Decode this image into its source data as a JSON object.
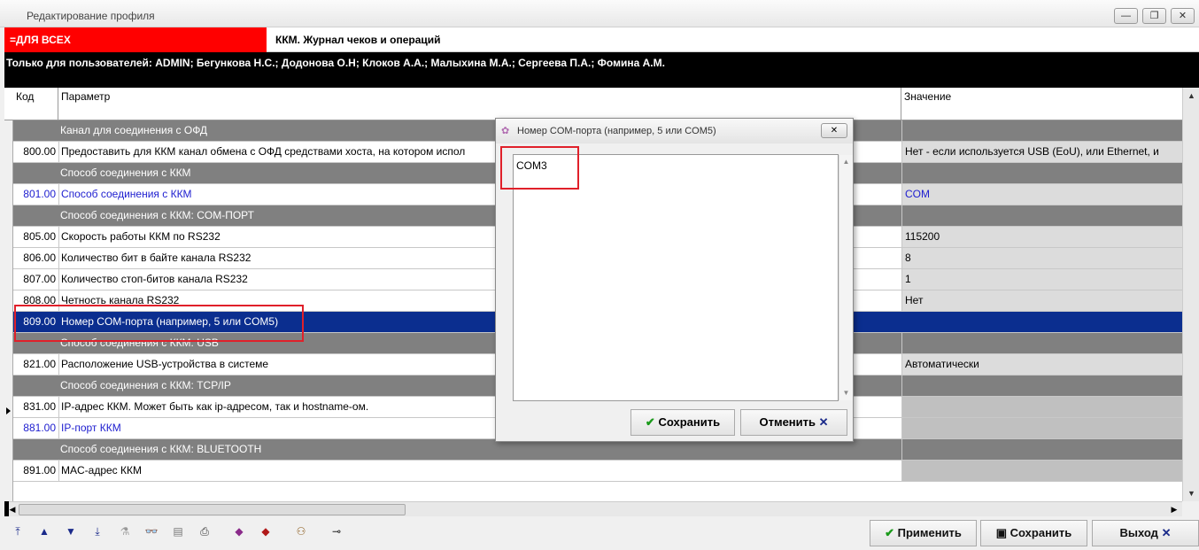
{
  "window": {
    "title": "Редактирование профиля",
    "min_glyph": "—",
    "max_glyph": "❐",
    "close_glyph": "✕"
  },
  "header": {
    "group": "=ДЛЯ ВСЕХ",
    "journal": "ККМ. Журнал чеков и операций",
    "users_line": "Только для пользователей: ADMIN; Бегункова Н.С.; Додонова О.Н; Клоков А.А.; Малыхина М.А.; Сергеева П.А.; Фомина А.М."
  },
  "grid": {
    "columns": {
      "code": "Код",
      "param": "Параметр",
      "value": "Значение"
    },
    "rows": [
      {
        "type": "group",
        "code": "",
        "param": "Канал для соединения с ОФД",
        "value": ""
      },
      {
        "type": "data",
        "code": "800.00",
        "param": "Предоставить для ККМ канал обмена с ОФД средствами хоста, на котором испол",
        "value": "Нет - если используется USB (EoU), или Ethernet, и"
      },
      {
        "type": "group",
        "code": "",
        "param": "Способ соединения с ККМ",
        "value": ""
      },
      {
        "type": "blue",
        "code": "801.00",
        "param": "Способ соединения с ККМ",
        "value": "COM"
      },
      {
        "type": "group",
        "code": "",
        "param": "Способ соединения с ККМ: COM-ПОРТ",
        "value": ""
      },
      {
        "type": "data",
        "code": "805.00",
        "param": "Скорость работы ККМ по RS232",
        "value": "115200"
      },
      {
        "type": "data",
        "code": "806.00",
        "param": "Количество бит в байте канала RS232",
        "value": "8"
      },
      {
        "type": "data",
        "code": "807.00",
        "param": "Количество стоп-битов канала RS232",
        "value": "1"
      },
      {
        "type": "data",
        "code": "808.00",
        "param": "Четность канала RS232",
        "value": "Нет"
      },
      {
        "type": "selected",
        "code": "809.00",
        "param": "Номер COM-порта (например, 5 или COM5)",
        "value": ""
      },
      {
        "type": "group",
        "code": "",
        "param": "Способ соединения с ККМ: USB",
        "value": ""
      },
      {
        "type": "data",
        "code": "821.00",
        "param": "Расположение USB-устройства в системе",
        "value": "Автоматически"
      },
      {
        "type": "group",
        "code": "",
        "param": "Способ соединения с ККМ: TCP/IP",
        "value": ""
      },
      {
        "type": "data-grayval",
        "code": "831.00",
        "param": "IP-адрес ККМ. Может быть как ip-адресом, так и hostname-ом.",
        "value": ""
      },
      {
        "type": "blue-grayval",
        "code": "881.00",
        "param": "IP-порт ККМ",
        "value": ""
      },
      {
        "type": "group",
        "code": "",
        "param": "Способ соединения с ККМ: BLUETOOTH",
        "value": ""
      },
      {
        "type": "data-grayval",
        "code": "891.00",
        "param": "MAC-адрес ККМ",
        "value": ""
      }
    ]
  },
  "dialog": {
    "title": "Номер COM-порта (например, 5 или COM5)",
    "value": "COM3",
    "save_label": "Сохранить",
    "cancel_label": "Отменить"
  },
  "footer": {
    "apply_label": "Применить",
    "save_label": "Сохранить",
    "exit_label": "Выход"
  }
}
